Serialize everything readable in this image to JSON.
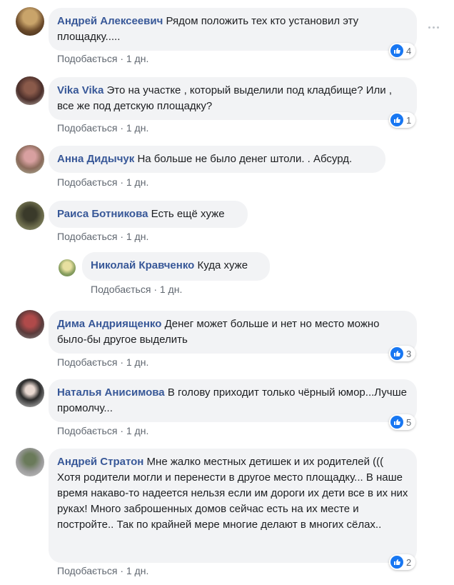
{
  "comments": [
    {
      "author": "Андрей Алексеевич",
      "text": "Рядом положить тех кто установил эту площадку.....",
      "like_label": "Подобається",
      "time": "1 дн.",
      "reactions": "4"
    },
    {
      "author": "Vika Vika",
      "text": "Это на участке , который выделили под кладбище? Или , все же под детскую площадку?",
      "like_label": "Подобається",
      "time": "1 дн.",
      "reactions": "1"
    },
    {
      "author": "Анна Дидычук",
      "text": "На больше не было денег штоли. . Абсурд.",
      "like_label": "Подобається",
      "time": "1 дн."
    },
    {
      "author": "Раиса Ботникова",
      "text": "Есть ещё хуже",
      "like_label": "Подобається",
      "time": "1 дн."
    },
    {
      "author": "Николай Кравченко",
      "text": "Куда хуже",
      "like_label": "Подобається",
      "time": "1 дн."
    },
    {
      "author": "Дима Андриященко",
      "text": "Денег может больше и нет но место можно было-бы другое выделить",
      "like_label": "Подобається",
      "time": "1 дн.",
      "reactions": "3"
    },
    {
      "author": "Наталья Анисимова",
      "text": "В голову приходит только чёрный юмор...Лучше промолчу...",
      "like_label": "Подобається",
      "time": "1 дн.",
      "reactions": "5"
    },
    {
      "author": "Андрей Стратон",
      "text": "Мне жалко местных детишек и их родителей (((",
      "text2": "Хотя родители могли и перенести в другое место площадку... В наше время накаво-то надеется нельзя если им дороги их дети все в их них руках! Много заброшенных домов сейчас есть на их месте и постройте.. Так по крайней мере многие делают в многих сёлах..",
      "like_label": "Подобається",
      "time": "1 дн.",
      "reactions": "2"
    }
  ],
  "separator": "·",
  "colors": {
    "author": "#385898",
    "bubble": "#f2f3f5",
    "meta": "#606770",
    "like": "#1877f2"
  }
}
